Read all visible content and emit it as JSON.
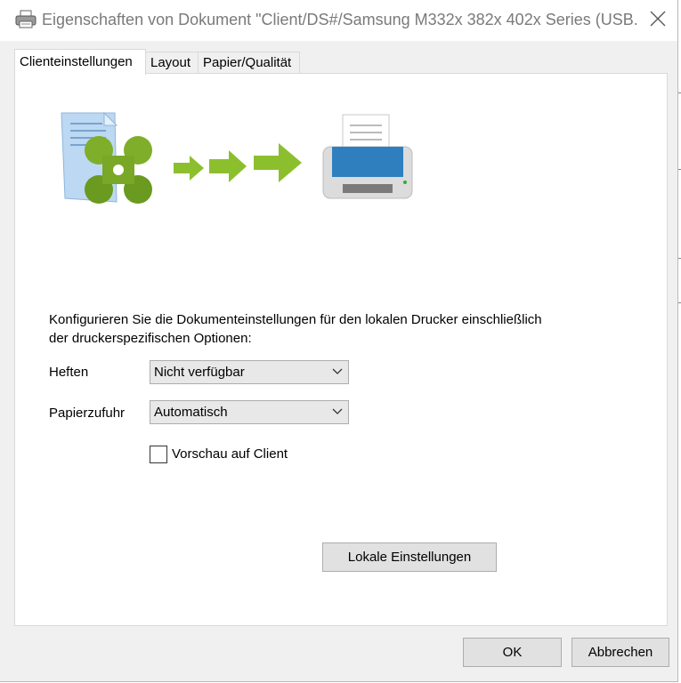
{
  "window": {
    "title": "Eigenschaften von Dokument \"Client/DS#/Samsung M332x 382x 402x Series (USB...",
    "icon": "printer-icon",
    "close_icon": "close-icon"
  },
  "tabs": [
    {
      "label": "Clienteinstellungen",
      "active": true
    },
    {
      "label": "Layout",
      "active": false
    },
    {
      "label": "Papier/Qualität",
      "active": false
    }
  ],
  "description_line1": "Konfigurieren Sie die Dokumenteinstellungen für den lokalen Drucker einschließlich",
  "description_line2": "der druckerspezifischen Optionen:",
  "fields": {
    "heften": {
      "label": "Heften",
      "value": "Nicht verfügbar"
    },
    "papierzufuhr": {
      "label": "Papierzufuhr",
      "value": "Automatisch"
    }
  },
  "preview_checkbox": {
    "label": "Vorschau auf Client",
    "checked": false
  },
  "local_settings_button": "Lokale Einstellungen",
  "footer": {
    "ok_label": "OK",
    "cancel_label": "Abbrechen"
  },
  "colors": {
    "accent_green": "#7fae2a",
    "printer_blue": "#2f7fbf",
    "dialog_bg": "#f0f0f0"
  }
}
